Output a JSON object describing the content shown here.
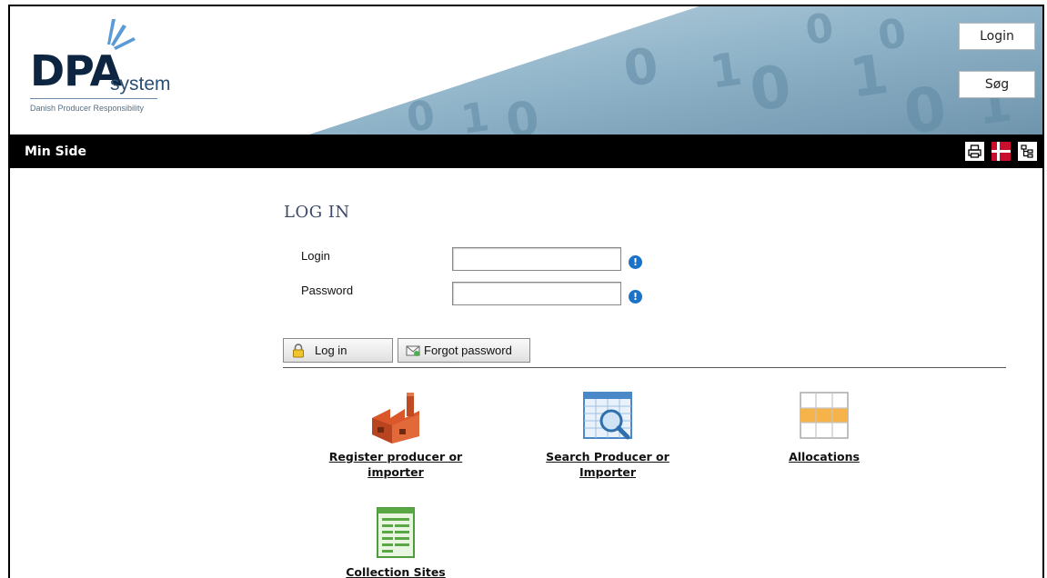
{
  "header": {
    "logo_text": "DPA",
    "logo_suffix": "system",
    "logo_tagline": "Danish Producer Responsibility",
    "login_button": "Login",
    "search_button": "Søg"
  },
  "nav": {
    "title": "Min Side",
    "icons": [
      "printer-icon",
      "danish-flag-icon",
      "sitemap-icon"
    ]
  },
  "login": {
    "title": "LOG IN",
    "login_label": "Login",
    "login_value": "",
    "password_label": "Password",
    "password_value": "",
    "info_glyph": "!",
    "login_button": "Log in",
    "forgot_button": "Forgot password"
  },
  "tiles": [
    {
      "label_line1": "Register producer or",
      "label_line2": "importer",
      "icon": "factory-icon"
    },
    {
      "label_line1": "Search Producer or",
      "label_line2": "Importer",
      "icon": "search-table-icon"
    },
    {
      "label_line1": "Allocations",
      "label_line2": "",
      "icon": "allocations-grid-icon"
    },
    {
      "label_line1": "Collection Sites",
      "label_line2": "",
      "icon": "list-document-icon"
    }
  ],
  "colors": {
    "banner_blue": "#8fb3c8",
    "navbar": "#000000",
    "title_color": "#3b4a6b",
    "info_icon": "#1a73c7"
  }
}
